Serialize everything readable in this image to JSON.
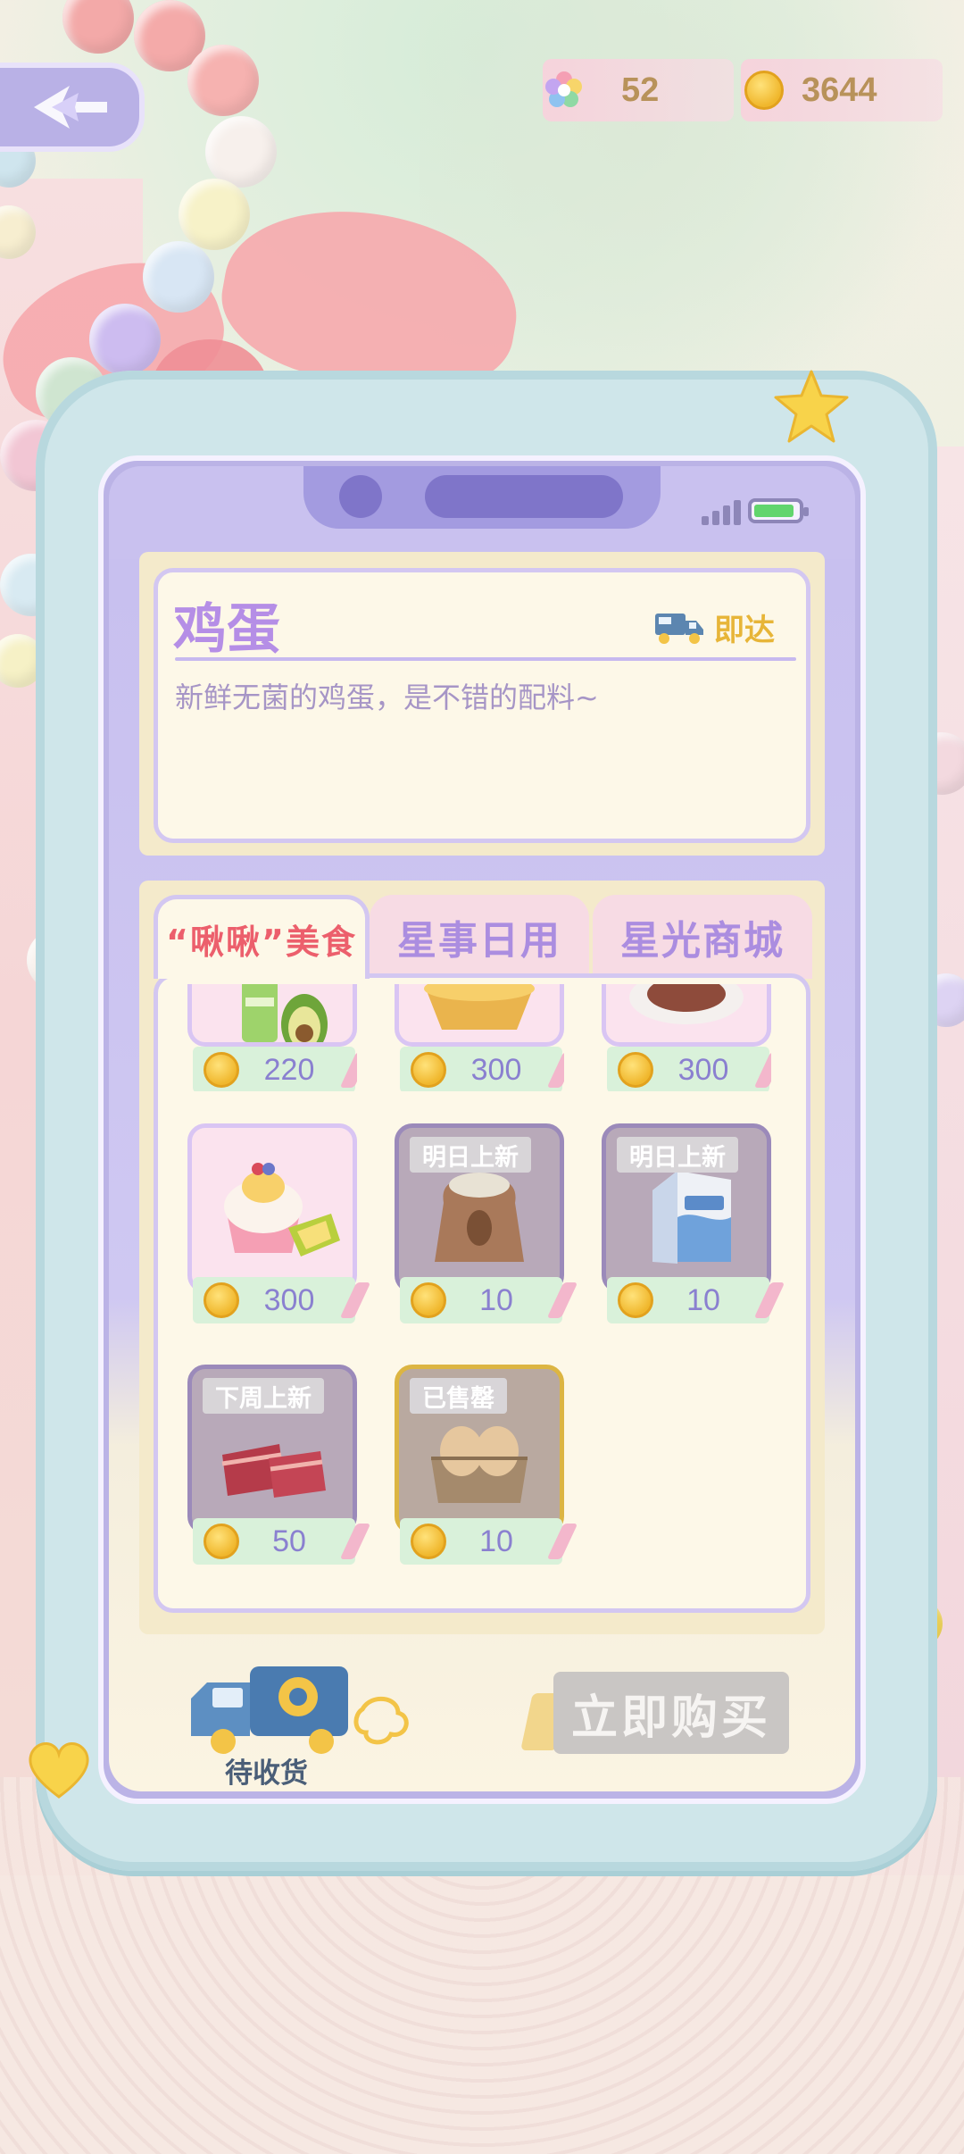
{
  "currencies": {
    "gems": {
      "icon": "rainbow-flower-icon",
      "value": "52"
    },
    "coins": {
      "icon": "gold-coin-icon",
      "value": "3644"
    }
  },
  "back_button": {
    "icon": "back-arrow-icon"
  },
  "item_detail": {
    "name": "鸡蛋",
    "delivery_label": "即达",
    "delivery_icon": "delivery-truck-icon",
    "description": "新鲜无菌的鸡蛋，是不错的配料~"
  },
  "tabs": [
    {
      "label": "“啾啾”美食",
      "active": true
    },
    {
      "label": "星事日用",
      "active": false
    },
    {
      "label": "星光商城",
      "active": false
    }
  ],
  "items": [
    {
      "icon": "drink-and-avocado-icon",
      "price": "220",
      "tag": "",
      "state": "normal"
    },
    {
      "icon": "egg-tart-icon",
      "price": "300",
      "tag": "",
      "state": "normal"
    },
    {
      "icon": "steak-plate-icon",
      "price": "300",
      "tag": "",
      "state": "normal"
    },
    {
      "icon": "durian-ice-cream-icon",
      "price": "300",
      "tag": "",
      "state": "normal"
    },
    {
      "icon": "flour-sack-icon",
      "price": "10",
      "tag": "明日上新",
      "state": "locked"
    },
    {
      "icon": "milk-carton-icon",
      "price": "10",
      "tag": "明日上新",
      "state": "locked"
    },
    {
      "icon": "bacon-icon",
      "price": "50",
      "tag": "下周上新",
      "state": "locked"
    },
    {
      "icon": "egg-carton-icon",
      "price": "10",
      "tag": "已售罄",
      "state": "sold"
    }
  ],
  "bottom": {
    "pending_label": "待收货",
    "pending_icon": "delivery-van-icon",
    "buy_label": "立即购买"
  },
  "colors": {
    "accent_purple": "#b58ee6",
    "active_tab_red": "#ec5f6c",
    "price_text": "#8a80d0",
    "coin_gold": "#f0b72d"
  }
}
